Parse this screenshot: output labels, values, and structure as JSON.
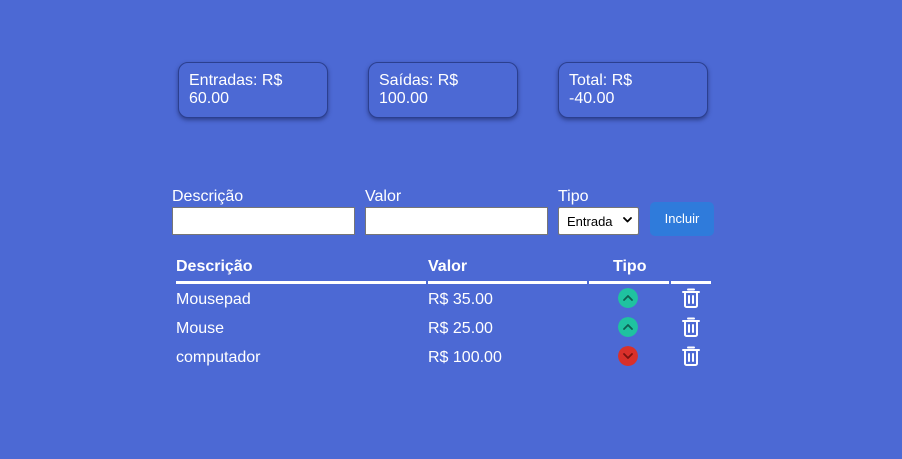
{
  "summary": {
    "entradas": {
      "label": "Entradas: R$",
      "value": "60.00"
    },
    "saidas": {
      "label": "Saídas: R$",
      "value": "100.00"
    },
    "total": {
      "label": "Total: R$",
      "value": "-40.00"
    }
  },
  "form": {
    "descricao_label": "Descrição",
    "descricao_value": "",
    "valor_label": "Valor",
    "valor_value": "",
    "tipo_label": "Tipo",
    "tipo_selected": "Entrada",
    "incluir_label": "Incluir"
  },
  "table": {
    "headers": {
      "descricao": "Descrição",
      "valor": "Valor",
      "tipo": "Tipo"
    },
    "rows": [
      {
        "descricao": "Mousepad",
        "valor": "R$ 35.00",
        "tipo": "entrada",
        "tipo_icon": "chevron-up-circle-icon"
      },
      {
        "descricao": "Mouse",
        "valor": "R$ 25.00",
        "tipo": "entrada",
        "tipo_icon": "chevron-up-circle-icon"
      },
      {
        "descricao": "computador",
        "valor": "R$ 100.00",
        "tipo": "saida",
        "tipo_icon": "chevron-down-circle-icon"
      }
    ],
    "delete_icon": "trash-icon"
  },
  "colors": {
    "background": "#4c69d4",
    "entrada": "#1fc2a0",
    "saida": "#d9302a",
    "button": "#2f7bdb"
  }
}
